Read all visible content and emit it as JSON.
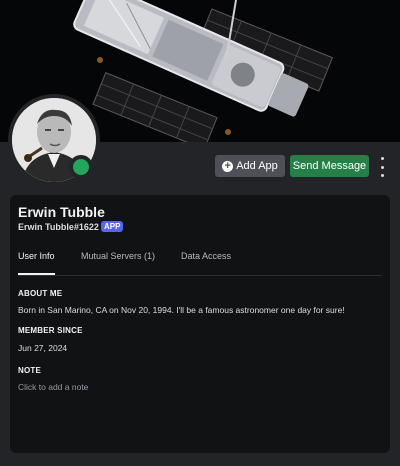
{
  "profile": {
    "display_name": "Erwin Tubble",
    "username": "Erwin Tubble#1622",
    "badge": "APP",
    "status_color": "#23a55a"
  },
  "actions": {
    "add_app_icon": "plus-circle-icon",
    "add_app_label": "Add App",
    "send_message_label": "Send Message",
    "more_icon": "vertical-dots-icon"
  },
  "tabs": [
    {
      "label": "User Info",
      "active": true
    },
    {
      "label": "Mutual Servers (1)",
      "active": false
    },
    {
      "label": "Data Access",
      "active": false
    }
  ],
  "user_info": {
    "about_label": "ABOUT ME",
    "about_text": "Born in San Marino, CA on Nov 20, 1994. I'll be a famous astronomer one day for sure!",
    "member_since_label": "MEMBER SINCE",
    "member_since": "Jun 27, 2024",
    "note_label": "NOTE",
    "note_placeholder": "Click to add a note"
  },
  "colors": {
    "accent": "#5865f2",
    "send_button": "#248046",
    "add_button": "#4e5058",
    "background": "#232428",
    "card": "#111214"
  }
}
